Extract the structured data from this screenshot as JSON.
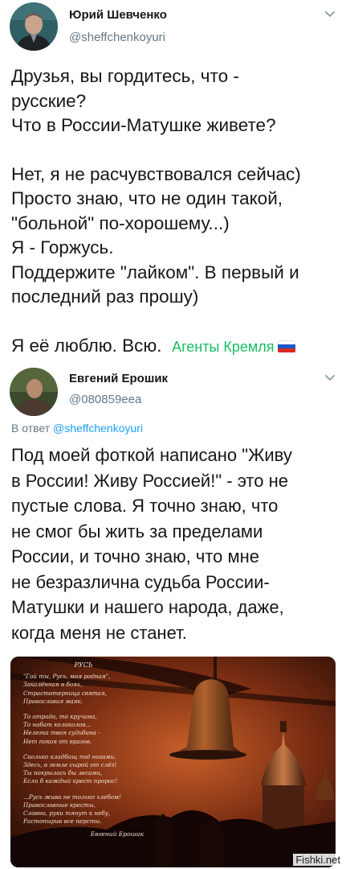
{
  "tweets": [
    {
      "author": {
        "name": "Юрий Шевченко",
        "handle": "@sheffchenkoyuri"
      },
      "lines": [
        "Друзья, вы гордитесь, что -",
        "русские?",
        "Что в России-Матушке живете?",
        "",
        "Нет, я не расчувствовался сейчас)",
        "Просто знаю, что не один такой,",
        "\"больной\" по-хорошему...)",
        "Я - Горжусь.",
        "Поддержите \"лайком\". В первый и",
        "последний раз прошу)",
        "",
        "Я её люблю. Всю."
      ],
      "hashtag": "Агенты Кремля",
      "icons": {
        "chevron": "chevron-down-icon",
        "flag": "russian-flag-emoji"
      }
    },
    {
      "author": {
        "name": "Евгений Ерошик",
        "handle": "@080859eea"
      },
      "reply_prefix": "В ответ",
      "reply_mention": "@sheffchenkoyuri",
      "lines": [
        "Под моей фоткой написано \"Живу",
        "в России! Живу Россией!\" - это не",
        "пустые слова. Я точно знаю, что",
        "не смог бы жить за пределами",
        "России, и точно знаю, что мне",
        "не безразлична судьба России-",
        "Матушки и нашего народа, даже,",
        "когда меня не станет."
      ],
      "image": {
        "title": "РУСЬ",
        "stanzas": [
          [
            "\"Гой ты, Русь, моя родная\",",
            "Закалённая в боях,",
            "Страстотерпица святая,",
            "Православия маяк."
          ],
          [
            "То отрада, то кручина,",
            "То набат колоколов...",
            "Нелегка твоя судьбина -",
            "Нет покоя от врагов."
          ],
          [
            "Сколько кладбищ под ногами,",
            "Здесь, в земле сырой от слёз!",
            "Ты покрылась бы лесами,",
            "Если б каждый крест пророс!"
          ],
          [
            "...Русь жива не только хлебом!",
            "Православные кресты,",
            "Словно, руки тянут к небу,",
            "Растопырив все персты."
          ]
        ],
        "signature": "Евгений Ерошик"
      }
    }
  ],
  "watermark": "Fishki.net",
  "colors": {
    "text": "#14171a",
    "secondary": "#657786",
    "link": "#1da1f2",
    "hashtag": "#17bf63"
  }
}
